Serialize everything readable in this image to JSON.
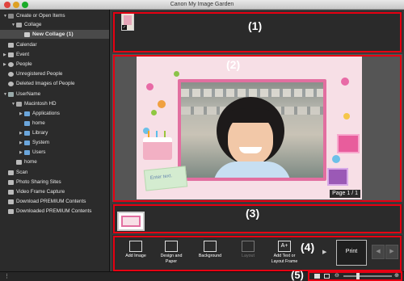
{
  "window": {
    "title": "Canon My Image Garden"
  },
  "sidebar": {
    "create": "Create or Open Items",
    "collage": "Collage",
    "new_collage": "New Collage (1)",
    "calendar": "Calendar",
    "event": "Event",
    "people": "People",
    "unregistered": "Unregistered People",
    "deleted": "Deleted Images of People",
    "username": "UserName",
    "macintosh": "Macintosh HD",
    "applications": "Applications",
    "home_folder": "home",
    "library": "Library",
    "system": "System",
    "users": "Users",
    "home": "home",
    "scan": "Scan",
    "photo_sharing": "Photo Sharing Sites",
    "video_frame": "Video Frame Capture",
    "download_premium": "Download PREMIUM Contents",
    "downloaded_premium": "Downloaded PREMIUM Contents"
  },
  "callouts": {
    "c1": "(1)",
    "c2": "(2)",
    "c3": "(3)",
    "c4": "(4)",
    "c5": "(5)"
  },
  "preview": {
    "enter_text": "Enter text.",
    "page_indicator": "Page 1 / 1"
  },
  "toolbar": {
    "add_image": "Add Image",
    "design_paper_1": "Design and",
    "design_paper_2": "Paper",
    "background": "Background",
    "layout": "Layout",
    "add_text_1": "Add Text or",
    "add_text_2": "Layout Frame",
    "print": "Print"
  },
  "colors": {
    "highlight": "#e60012",
    "collage_frame": "#e26fa0",
    "paper": "#f7dfe6"
  }
}
